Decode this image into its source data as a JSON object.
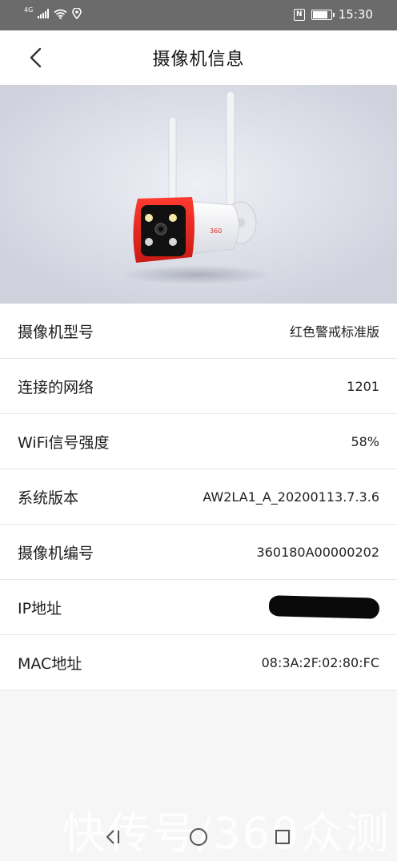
{
  "status_bar": {
    "network_type": "4G",
    "time": "15:30",
    "signal_icon": "signal-bars-icon",
    "wifi_icon": "wifi-icon",
    "location_icon": "location-pin-icon",
    "nfc_label": "N",
    "battery_icon": "battery-icon"
  },
  "header": {
    "title": "摄像机信息",
    "back_icon": "chevron-left-icon"
  },
  "hero": {
    "image": "camera-product-image",
    "brand_mark": "360"
  },
  "info": [
    {
      "label": "摄像机型号",
      "value": "红色警戒标准版"
    },
    {
      "label": "连接的网络",
      "value": "1201"
    },
    {
      "label": "WiFi信号强度",
      "value": "58%"
    },
    {
      "label": "系统版本",
      "value": "AW2LA1_A_20200113.7.3.6"
    },
    {
      "label": "摄像机编号",
      "value": "360180A00000202"
    },
    {
      "label": "IP地址",
      "value": ""
    },
    {
      "label": "MAC地址",
      "value": "08:3A:2F:02:80:FC"
    }
  ],
  "nav_bar": {
    "back_icon": "nav-back-icon",
    "home_icon": "nav-home-icon",
    "recent_icon": "nav-recent-icon"
  },
  "watermark": "快传号/360众测",
  "colors": {
    "status_bar_bg": "#6b6b6b",
    "camera_red": "#e8251f",
    "page_bg": "#f6f6f6"
  }
}
